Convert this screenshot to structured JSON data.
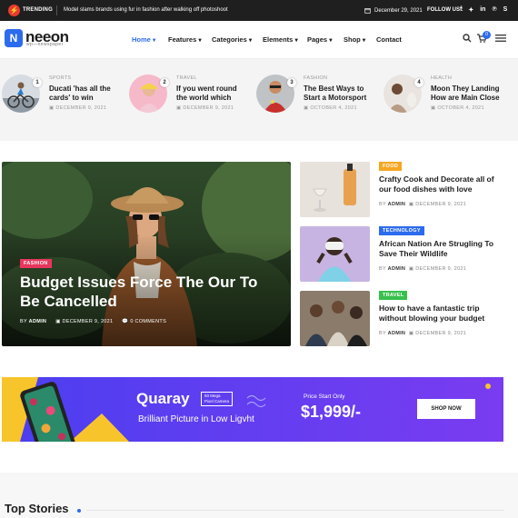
{
  "topbar": {
    "trending_label": "TRENDING",
    "trending_text": "Model slams brands using fur in fashion after walking off photoshoot",
    "date": "December 29, 2021",
    "follow_label": "FOLLOW US :",
    "social_icons": [
      "facebook-icon",
      "twitter-icon",
      "linkedin-icon",
      "pinterest-icon",
      "skype-icon"
    ]
  },
  "brand": {
    "name": "neeon",
    "tagline": "wp—newspaper",
    "accent": "#2c6bed"
  },
  "nav": {
    "items": [
      {
        "label": "Home",
        "has_menu": true,
        "active": true
      },
      {
        "label": "Features",
        "has_menu": true
      },
      {
        "label": "Categories",
        "has_menu": true
      },
      {
        "label": "Elements",
        "has_menu": true
      },
      {
        "label": "Pages",
        "has_menu": true
      },
      {
        "label": "Shop",
        "has_menu": true
      },
      {
        "label": "Contact",
        "has_menu": false
      }
    ],
    "cart_count": "0",
    "chevron": "▾"
  },
  "mini_posts": [
    {
      "num": "1",
      "category": "SPORTS",
      "title": "Ducati 'has all the cards' to win",
      "date": "DECEMBER 9, 2021"
    },
    {
      "num": "2",
      "category": "TRAVEL",
      "title": "If you went round the world which",
      "date": "DECEMBER 9, 2021"
    },
    {
      "num": "3",
      "category": "FASHION",
      "title": "The Best Ways to Start a Motorsport",
      "date": "OCTOBER 4, 2021"
    },
    {
      "num": "4",
      "category": "HEALTH",
      "title": "Moon They Landing How are Main Close",
      "date": "OCTOBER 4, 2021"
    }
  ],
  "hero": {
    "tag": "FASHION",
    "tag_color": "#e8365d",
    "title": "Budget Issues Force The Our To Be Cancelled",
    "by": "BY",
    "author": "ADMIN",
    "date": "DECEMBER 9, 2021",
    "comments": "0 COMMENTS"
  },
  "side_posts": [
    {
      "tag": "FOOD",
      "tag_color": "#f5a623",
      "title": "Crafty Cook and Decorate all of our food dishes with love",
      "by": "BY",
      "author": "ADMIN",
      "date": "DECEMBER 9, 2021"
    },
    {
      "tag": "TECHNOLOGY",
      "tag_color": "#2c6bed",
      "title": "African Nation Are Strugling To Save Their Wildlife",
      "by": "BY",
      "author": "ADMIN",
      "date": "DECEMBER 9, 2021"
    },
    {
      "tag": "TRAVEL",
      "tag_color": "#38c04d",
      "title": "How to have a fantastic trip without blowing your budget",
      "by": "BY",
      "author": "ADMIN",
      "date": "DECEMBER 9, 2021"
    }
  ],
  "promo": {
    "brand": "Quaray",
    "badge_line1": "50 Mega",
    "badge_line2": "Pixel Camera",
    "subtitle": "Brilliant Picture in Low Ligvht",
    "price_label": "Price Start Only",
    "price": "$1,999/-",
    "button": "SHOP NOW"
  },
  "section": {
    "title": "Top Stories"
  }
}
